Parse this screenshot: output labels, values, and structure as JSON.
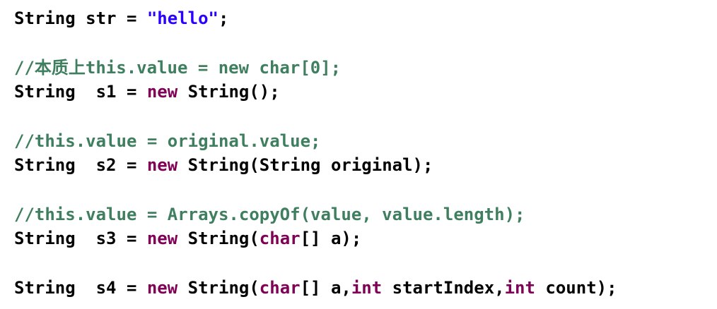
{
  "colors": {
    "plain": "#000000",
    "string": "#2a00ff",
    "comment": "#3f7f5f",
    "keyword": "#7f0055",
    "background": "#ffffff"
  },
  "code": {
    "line1": {
      "a": "String str = ",
      "str": "\"hello\"",
      "b": ";"
    },
    "line2": {
      "comment": "//本质上this.value = new char[0];"
    },
    "line3": {
      "a": "String  s1 = ",
      "kw_new": "new",
      "b": " String();"
    },
    "line4": {
      "comment": "//this.value = original.value;"
    },
    "line5": {
      "a": "String  s2 = ",
      "kw_new": "new",
      "b": " String(String original);"
    },
    "line6": {
      "comment": "//this.value = Arrays.copyOf(value, value.length);"
    },
    "line7": {
      "a": "String  s3 = ",
      "kw_new": "new",
      "b": " String(",
      "kw_char": "char",
      "c": "[] a);"
    },
    "line8": {
      "a": "String  s4 = ",
      "kw_new": "new",
      "b": " String(",
      "kw_char": "char",
      "c": "[] a,",
      "kw_int1": "int",
      "d": " startIndex,",
      "kw_int2": "int",
      "e": " count);"
    }
  }
}
